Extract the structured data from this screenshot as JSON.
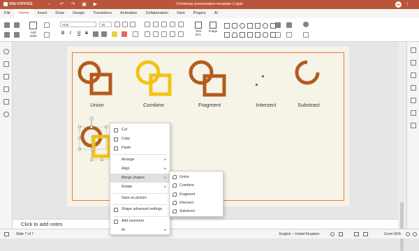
{
  "app": {
    "logo_text": "ONLYOFFICE",
    "title": "Christmas presentation template 2.pptx",
    "user_initials": "HD"
  },
  "menu": [
    "File",
    "Home",
    "Insert",
    "Draw",
    "Design",
    "Transitions",
    "Animation",
    "Collaboration",
    "View",
    "Plugins",
    "AI"
  ],
  "menu_active": "Home",
  "toolbar": {
    "add_slide": "Add Slide",
    "font": "Arial",
    "size": "18",
    "bold": "B",
    "italic": "I",
    "underline": "U",
    "strike": "S",
    "text_box": "Text Box",
    "image": "Image"
  },
  "slide": {
    "labels": [
      "Union",
      "Combine",
      "Fragment",
      "Intersect",
      "Substract"
    ],
    "colors": {
      "brown": "#b35c1e",
      "yellow": "#f2c314",
      "border": "#e8744a",
      "bg": "#f6f3e7"
    }
  },
  "context_menu": {
    "items": [
      "Cut",
      "Copy",
      "Paste",
      "Arrange",
      "Align",
      "Merge shapes",
      "Rotate",
      "Save as picture",
      "Shape advanced settings",
      "Add comment",
      "AI"
    ],
    "submenu": [
      "Union",
      "Combine",
      "Fragment",
      "Intersect",
      "Substract"
    ]
  },
  "notes_placeholder": "Click to add notes",
  "status": {
    "slide": "Slide 7 of 7",
    "language": "English – United Kingdom",
    "zoom": "Zoom 66%"
  }
}
